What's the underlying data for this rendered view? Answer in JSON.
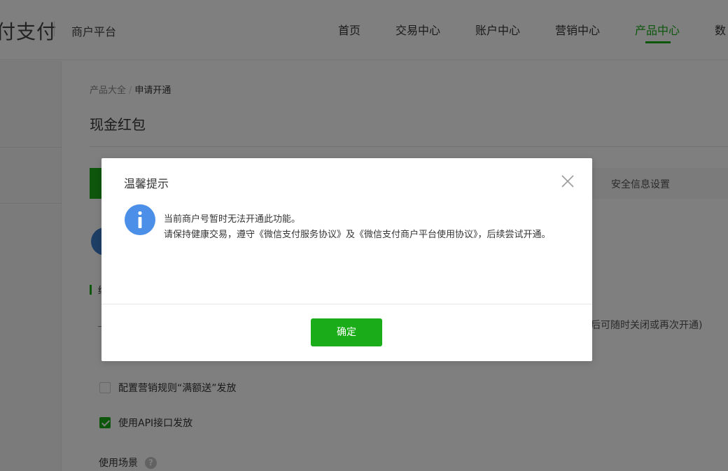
{
  "header": {
    "logo_text": "付支付",
    "platform": "商户平台",
    "nav": [
      "首页",
      "交易中心",
      "账户中心",
      "营销中心",
      "产品中心",
      "数"
    ],
    "active_nav": "产品中心"
  },
  "breadcrumb": {
    "parent": "产品大全",
    "current": "申请开通"
  },
  "page_title": "现金红包",
  "step_bar": {
    "right_label": "安全信息设置"
  },
  "section": {
    "label": "绑"
  },
  "hint_right": "通后可随时关闭或再次开通)",
  "options": [
    {
      "label": "配置营销规则“满额送”发放",
      "checked": false
    },
    {
      "label": "使用API接口发放",
      "checked": true
    }
  ],
  "scene": {
    "label": "使用场景",
    "help": "?"
  },
  "dialog": {
    "title": "温馨提示",
    "line1": "当前商户号暂时无法开通此功能。",
    "line2": "请保持健康交易，遵守《微信支付服务协议》及《微信支付商户平台使用协议》，后续尝试开通。",
    "confirm_label": "确定"
  },
  "colors": {
    "accent": "#1aad19",
    "info": "#4c8fe8"
  },
  "icons": {
    "close": "close-icon",
    "info": "info-icon",
    "help": "help-icon",
    "check": "checkmark-icon"
  }
}
